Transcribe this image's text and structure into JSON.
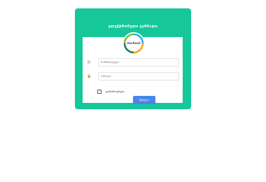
{
  "card": {
    "title": "ელექტრონული ჟურნალი",
    "bg_color": "#16c79a"
  },
  "logo": {
    "text": "eschool",
    "icon": "logo-ring"
  },
  "form": {
    "username_placeholder": "მომხმარებელი",
    "password_placeholder": "პაროლი",
    "remember_label": "დამახსოვრება",
    "submit_label": "შესვლა"
  },
  "icons": {
    "username": "user-icon",
    "password": "lock-icon"
  },
  "colors": {
    "button": "#4a86e8"
  }
}
